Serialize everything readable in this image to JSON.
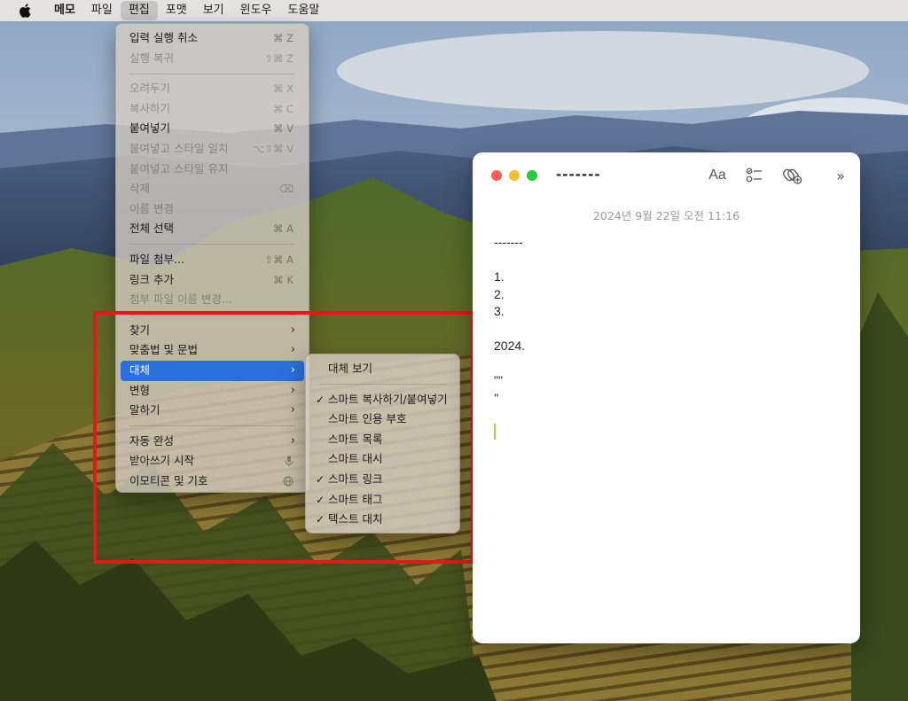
{
  "menubar": {
    "app_name": "메모",
    "items": [
      "파일",
      "편집",
      "포맷",
      "보기",
      "윈도우",
      "도움말"
    ],
    "active_index": 1
  },
  "edit_menu": {
    "items": [
      {
        "label": "입력 실행 취소",
        "shortcut": "⌘ Z",
        "state": "enabled"
      },
      {
        "label": "실행 복귀",
        "shortcut": "⇧⌘ Z",
        "state": "disabled"
      },
      {
        "label": "오려두기",
        "shortcut": "⌘ X",
        "state": "disabled"
      },
      {
        "label": "복사하기",
        "shortcut": "⌘ C",
        "state": "disabled"
      },
      {
        "label": "붙여넣기",
        "shortcut": "⌘ V",
        "state": "enabled"
      },
      {
        "label": "붙여넣고 스타일 일치",
        "shortcut": "⌥⇧⌘ V",
        "state": "disabled"
      },
      {
        "label": "붙여넣고 스타일 유지",
        "shortcut": "",
        "state": "disabled"
      },
      {
        "label": "삭제",
        "shortcut": "⌫",
        "state": "disabled"
      },
      {
        "label": "이름 변경",
        "shortcut": "",
        "state": "disabled"
      },
      {
        "label": "전체 선택",
        "shortcut": "⌘ A",
        "state": "enabled"
      },
      {
        "label": "파일 첨부...",
        "shortcut": "⇧⌘ A",
        "state": "enabled"
      },
      {
        "label": "링크 추가",
        "shortcut": "⌘ K",
        "state": "enabled"
      },
      {
        "label": "첨부 파일 이름 변경...",
        "shortcut": "",
        "state": "disabled"
      },
      {
        "label": "찾기",
        "submenu": true
      },
      {
        "label": "맞춤법 및 문법",
        "submenu": true
      },
      {
        "label": "대체",
        "submenu": true,
        "highlighted": true
      },
      {
        "label": "변형",
        "submenu": true
      },
      {
        "label": "말하기",
        "submenu": true
      },
      {
        "label": "자동 완성",
        "submenu": true
      },
      {
        "label": "받아쓰기 시작",
        "icon": "microphone-icon"
      },
      {
        "label": "이모티콘 및 기호",
        "icon": "globe-icon"
      }
    ]
  },
  "substitutions_menu": {
    "header": "대체 보기",
    "items": [
      {
        "label": "스마트 복사하기/붙여넣기",
        "checked": true
      },
      {
        "label": "스마트 인용 부호",
        "checked": false
      },
      {
        "label": "스마트 목록",
        "checked": false
      },
      {
        "label": "스마트 대시",
        "checked": false
      },
      {
        "label": "스마트 링크",
        "checked": true
      },
      {
        "label": "스마트 태그",
        "checked": true
      },
      {
        "label": "텍스트 대치",
        "checked": true
      }
    ],
    "check_mark": "✓"
  },
  "note_window": {
    "title": "-------",
    "toolbar": {
      "format_label": "Aa",
      "more_label": "»"
    },
    "date": "2024년 9월 22일 오전 11:16",
    "lines": [
      "-------",
      "",
      "1.",
      "2.",
      "3.",
      "",
      "2024.",
      "",
      "\"\"",
      "''"
    ]
  },
  "colors": {
    "highlight": "#2b6fd8",
    "annotation_box": "#e01919",
    "cursor": "#e7b43a"
  }
}
